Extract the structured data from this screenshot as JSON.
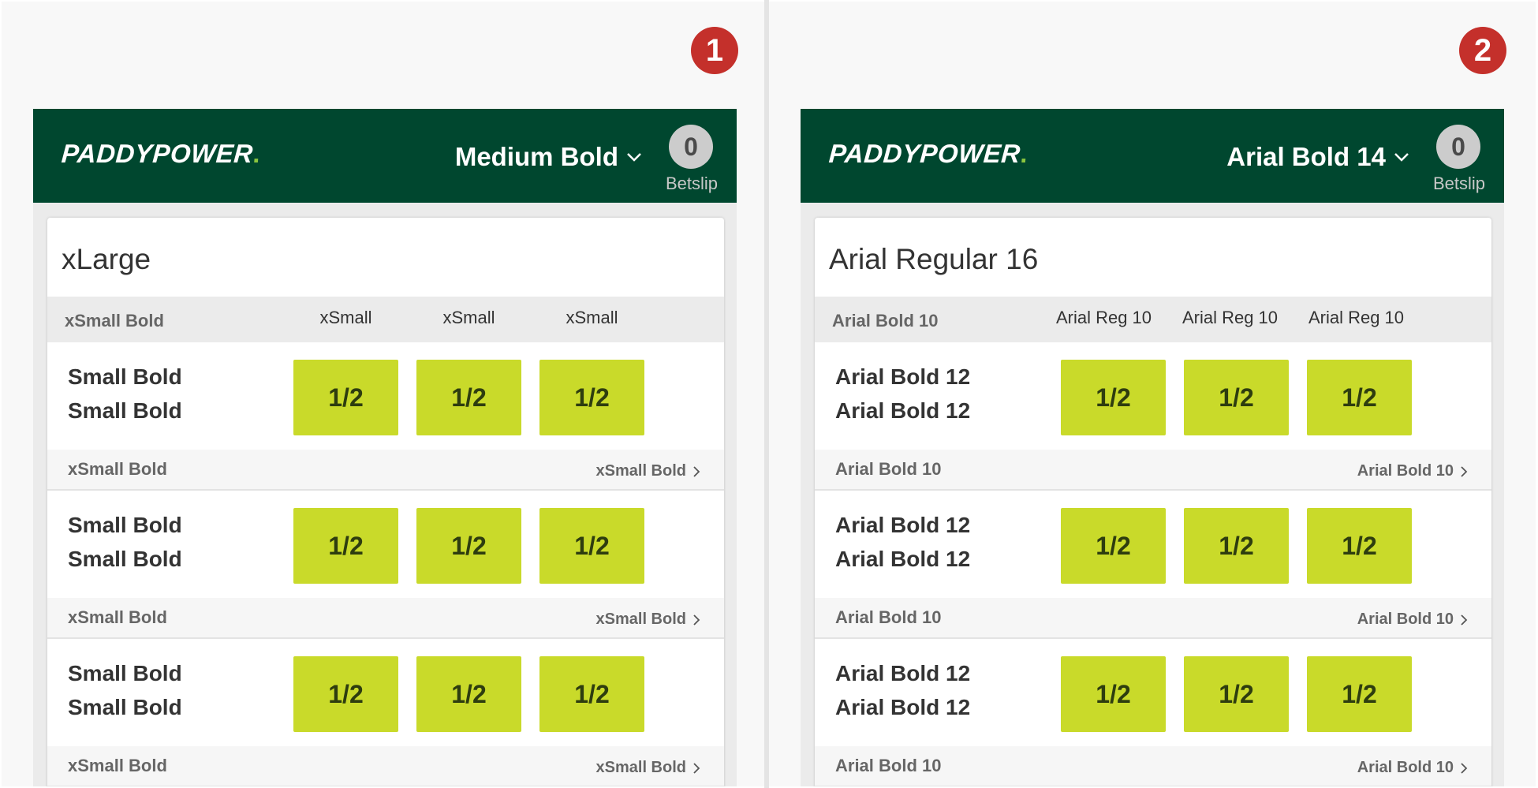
{
  "panels": [
    {
      "badge": "1",
      "header": {
        "logo": "PADDYPOWER",
        "logo_dot": ".",
        "font_select": "Medium Bold",
        "betslip_count": "0",
        "betslip_label": "Betslip"
      },
      "card_title": "xLarge",
      "column_header": {
        "label": "xSmall Bold",
        "cols": [
          "xSmall",
          "xSmall",
          "xSmall"
        ]
      },
      "rows": [
        {
          "name1": "Small Bold",
          "name2": "Small Bold",
          "odds": [
            "1/2",
            "1/2",
            "1/2"
          ],
          "sub_left": "xSmall Bold",
          "sub_right": "xSmall Bold"
        },
        {
          "name1": "Small Bold",
          "name2": "Small Bold",
          "odds": [
            "1/2",
            "1/2",
            "1/2"
          ],
          "sub_left": "xSmall Bold",
          "sub_right": "xSmall Bold"
        },
        {
          "name1": "Small Bold",
          "name2": "Small Bold",
          "odds": [
            "1/2",
            "1/2",
            "1/2"
          ],
          "sub_left": "xSmall Bold",
          "sub_right": "xSmall Bold"
        }
      ]
    },
    {
      "badge": "2",
      "header": {
        "logo": "PADDYPOWER",
        "logo_dot": ".",
        "font_select": "Arial Bold 14",
        "betslip_count": "0",
        "betslip_label": "Betslip"
      },
      "card_title": "Arial Regular 16",
      "column_header": {
        "label": "Arial Bold 10",
        "cols": [
          "Arial Reg 10",
          "Arial Reg 10",
          "Arial Reg 10"
        ]
      },
      "rows": [
        {
          "name1": "Arial Bold 12",
          "name2": "Arial Bold 12",
          "odds": [
            "1/2",
            "1/2",
            "1/2"
          ],
          "sub_left": "Arial Bold 10",
          "sub_right": "Arial Bold 10"
        },
        {
          "name1": "Arial Bold 12",
          "name2": "Arial Bold 12",
          "odds": [
            "1/2",
            "1/2",
            "1/2"
          ],
          "sub_left": "Arial Bold 10",
          "sub_right": "Arial Bold 10"
        },
        {
          "name1": "Arial Bold 12",
          "name2": "Arial Bold 12",
          "odds": [
            "1/2",
            "1/2",
            "1/2"
          ],
          "sub_left": "Arial Bold 10",
          "sub_right": "Arial Bold 10"
        }
      ]
    }
  ],
  "colors": {
    "header_bg": "#00472f",
    "odds_bg": "#c9da2a",
    "badge_bg": "#c4302b",
    "logo_dot": "#8bc53f"
  },
  "icons": {
    "dropdown": "chevron-down-icon",
    "sub_link": "chevron-right-icon"
  }
}
